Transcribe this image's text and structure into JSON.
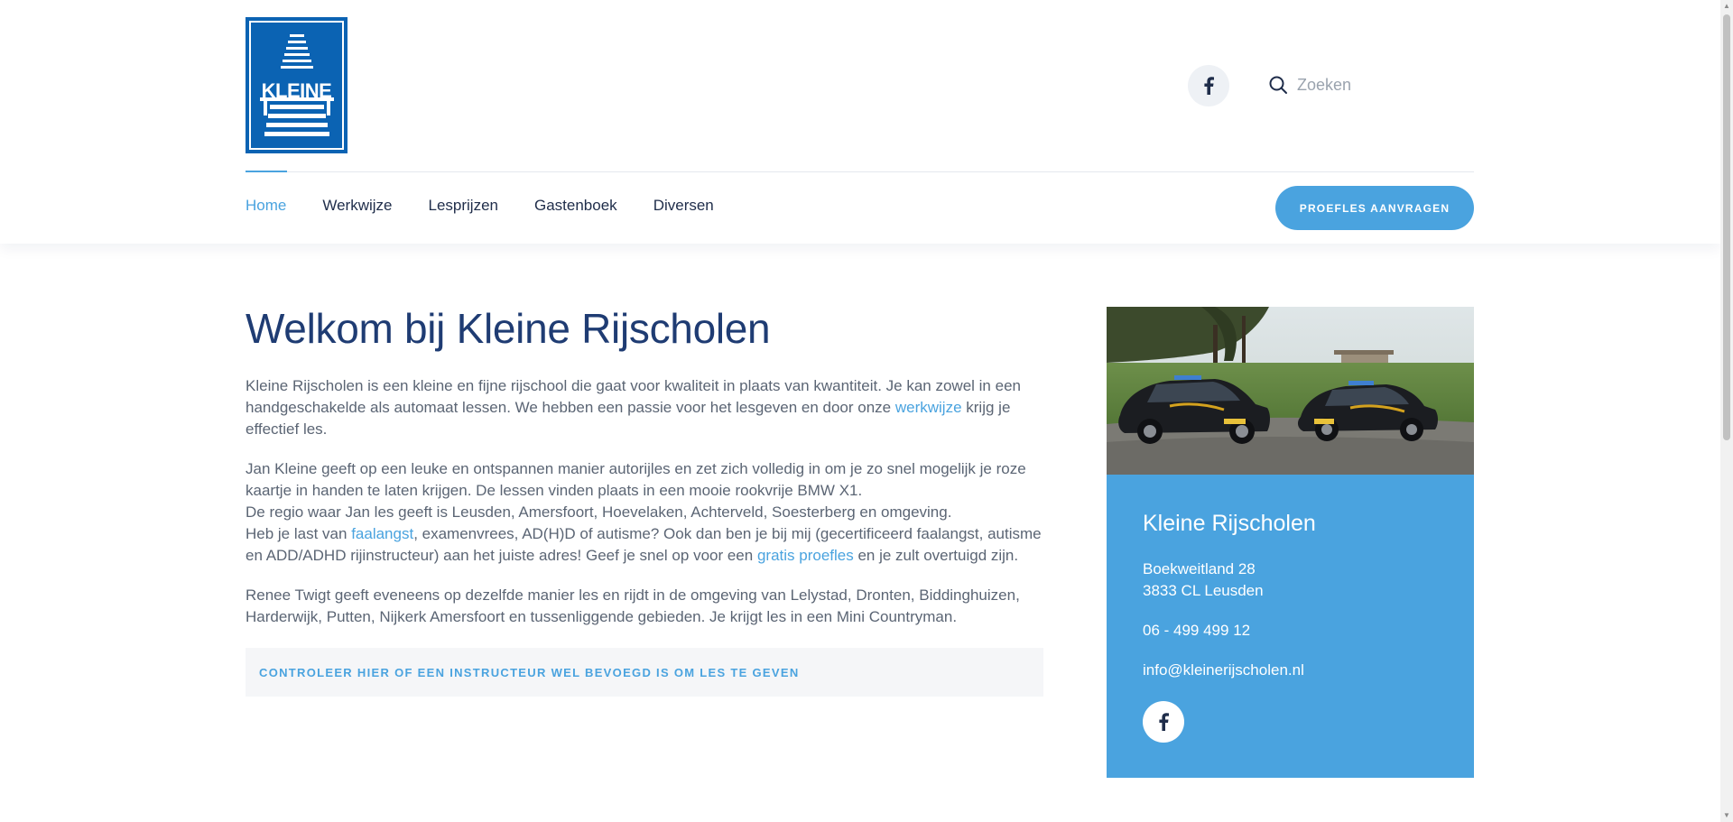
{
  "logo": {
    "alt": "KLEINE RIJSCHOLEN",
    "wordmark": "KLEINE"
  },
  "header": {
    "search": {
      "placeholder": "Zoeken"
    }
  },
  "nav": {
    "items": [
      {
        "label": "Home",
        "active": true
      },
      {
        "label": "Werkwijze",
        "active": false
      },
      {
        "label": "Lesprijzen",
        "active": false
      },
      {
        "label": "Gastenboek",
        "active": false
      },
      {
        "label": "Diversen",
        "active": false
      }
    ],
    "cta_label": "PROEFLES AANVRAGEN"
  },
  "main": {
    "title": "Welkom bij Kleine Rijscholen",
    "p1_a": "Kleine Rijscholen is een kleine en fijne rijschool die gaat voor kwaliteit in plaats van kwantiteit. Je kan zowel in een handgeschakelde als automaat lessen. We hebben een passie voor het lesgeven en door onze ",
    "p1_link": "werkwijze",
    "p1_b": " krijg je effectief les.",
    "p2_line1": "Jan Kleine geeft op een leuke en ontspannen manier autorijles en zet zich volledig in om je zo snel mogelijk je roze kaartje in handen te laten krijgen. De lessen vinden plaats in een mooie rookvrije BMW X1.",
    "p2_line2": "De regio waar Jan les geeft is Leusden, Amersfoort, Hoevelaken, Achterveld, Soesterberg en omgeving.",
    "p2_line3_a": "Heb je last van ",
    "p2_link1": "faalangst",
    "p2_line3_b": ", examenvrees, AD(H)D of autisme? Ook dan ben je bij mij (gecertificeerd faalangst, autisme en ADD/ADHD rijinstructeur) aan het juiste adres! Geef je snel op voor een ",
    "p2_link2": "gratis proefles",
    "p2_line3_c": " en je zult overtuigd zijn.",
    "p3": "Renee Twigt geeft eveneens op dezelfde manier les en rijdt in de omgeving van Lelystad, Dronten, Biddinghuizen, Harderwijk, Putten, Nijkerk Amersfoort en tussenliggende gebieden. Je krijgt les in een Mini Countryman.",
    "verify_label": "CONTROLEER HIER OF EEN INSTRUCTEUR WEL BEVOEGD IS OM LES TE GEVEN"
  },
  "sidebar": {
    "title": "Kleine Rijscholen",
    "address1": "Boekweitland 28",
    "address2": "3833 CL Leusden",
    "phone": "06 - 499 499 12",
    "email": "info@kleinerijscholen.nl",
    "photo_alt": "Twee zwarte lesauto's van Kleine Rijscholen"
  },
  "colors": {
    "accent": "#4aa3df",
    "heading": "#1f3c73",
    "nav_text": "#1f2d4a",
    "logo_blue": "#0b63b3"
  },
  "icons": {
    "facebook": "facebook-icon",
    "search": "search-icon"
  }
}
